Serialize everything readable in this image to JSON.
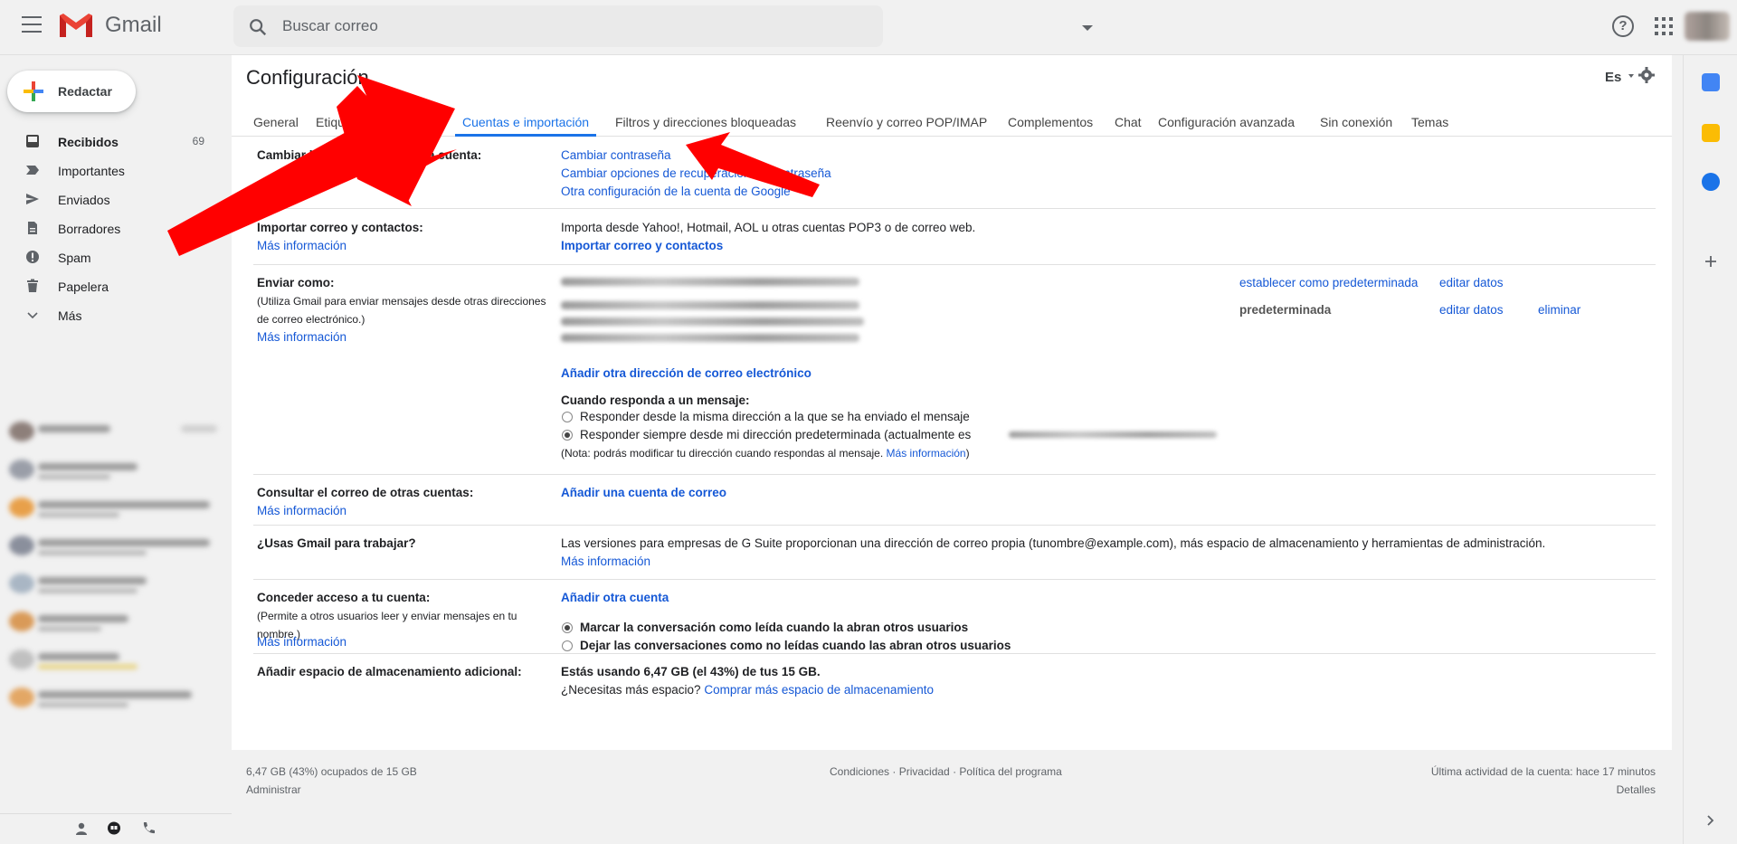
{
  "app": {
    "brand": "Gmail"
  },
  "search": {
    "placeholder": "Buscar correo"
  },
  "nav": {
    "compose": "Redactar",
    "items": [
      {
        "label": "Recibidos",
        "count": "69",
        "icon": "inbox-icon"
      },
      {
        "label": "Importantes",
        "count": "",
        "icon": "important-icon"
      },
      {
        "label": "Enviados",
        "count": "",
        "icon": "send-icon"
      },
      {
        "label": "Borradores",
        "count": "",
        "icon": "draft-icon"
      },
      {
        "label": "Spam",
        "count": "",
        "icon": "spam-icon"
      },
      {
        "label": "Papelera",
        "count": "",
        "icon": "trash-icon"
      },
      {
        "label": "Más",
        "count": "",
        "icon": "chevron-down-icon"
      }
    ]
  },
  "page": {
    "title": "Configuración",
    "lang": "Es"
  },
  "tabs": [
    "General",
    "Etiquetas",
    "Cuentas e importación",
    "Filtros y direcciones bloqueadas",
    "Reenvío y correo POP/IMAP",
    "Complementos",
    "Chat",
    "Configuración avanzada",
    "Sin conexión",
    "Temas"
  ],
  "settings": {
    "change": {
      "label": "Cambiar la configuración de la cuenta:",
      "links": [
        "Cambiar contraseña",
        "Cambiar opciones de recuperación de contraseña",
        "Otra configuración de la cuenta de Google"
      ]
    },
    "import": {
      "label": "Importar correo y contactos:",
      "more": "Más información",
      "desc": "Importa desde Yahoo!, Hotmail, AOL u otras cuentas POP3 o de correo web.",
      "action": "Importar correo y contactos"
    },
    "sendas": {
      "label": "Enviar como:",
      "sub": "(Utiliza Gmail para enviar mensajes desde otras direcciones de correo electrónico.)",
      "more": "Más información",
      "set_default": "establecer como predeterminada",
      "edit": "editar datos",
      "default": "predeterminada",
      "edit2": "editar datos",
      "delete": "eliminar",
      "add": "Añadir otra dirección de correo electrónico",
      "reply_label": "Cuando responda a un mensaje:",
      "reply_opt1": "Responder desde la misma dirección a la que se ha enviado el mensaje",
      "reply_opt2": "Responder siempre desde mi dirección predeterminada (actualmente es",
      "note_pre": "(Nota: podrás modificar tu dirección cuando respondas al mensaje.",
      "note_link": "Más información",
      "note_post": ")"
    },
    "check": {
      "label": "Consultar el correo de otras cuentas:",
      "more": "Más información",
      "action": "Añadir una cuenta de correo"
    },
    "work": {
      "label": "¿Usas Gmail para trabajar?",
      "desc": "Las versiones para empresas de G Suite proporcionan una dirección de correo propia (tunombre@example.com), más espacio de almacenamiento y herramientas de administración.",
      "more": "Más información"
    },
    "grant": {
      "label": "Conceder acceso a tu cuenta:",
      "sub": "(Permite a otros usuarios leer y enviar mensajes en tu nombre.)",
      "more": "Más información",
      "action": "Añadir otra cuenta",
      "opt1": "Marcar la conversación como leída cuando la abran otros usuarios",
      "opt2": "Dejar las conversaciones como no leídas cuando las abran otros usuarios"
    },
    "storage": {
      "label": "Añadir espacio de almacenamiento adicional:",
      "usage": "Estás usando 6,47 GB (el 43%) de tus 15 GB.",
      "need": "¿Necesitas más espacio?",
      "buy": "Comprar más espacio de almacenamiento"
    }
  },
  "footer": {
    "usage": "6,47 GB (43%) ocupados de 15 GB",
    "manage": "Administrar",
    "links": "Condiciones · Privacidad · Política del programa",
    "activity": "Última actividad de la cuenta: hace 17 minutos",
    "details": "Detalles"
  },
  "colors": {
    "link": "#1558d6",
    "accent": "#1a73e8",
    "arrow": "#ff0000"
  }
}
